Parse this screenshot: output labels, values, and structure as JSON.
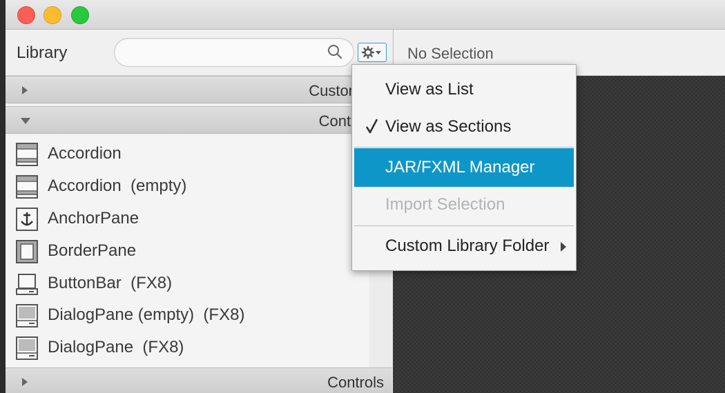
{
  "library": {
    "title": "Library",
    "search": {
      "placeholder": "",
      "value": ""
    },
    "sections": [
      {
        "label": "Custom",
        "expanded": false
      },
      {
        "label": "Containers",
        "expanded": true
      },
      {
        "label": "Controls",
        "expanded": false
      }
    ],
    "items": [
      {
        "label": "Accordion",
        "icon": "accordion-icon"
      },
      {
        "label": "Accordion  (empty)",
        "icon": "accordion-icon"
      },
      {
        "label": "AnchorPane",
        "icon": "anchor-icon"
      },
      {
        "label": "BorderPane",
        "icon": "borderpane-icon"
      },
      {
        "label": "ButtonBar  (FX8)",
        "icon": "buttonbar-icon"
      },
      {
        "label": "DialogPane (empty)  (FX8)",
        "icon": "dialogpane-icon"
      },
      {
        "label": "DialogPane  (FX8)",
        "icon": "dialogpane-icon"
      }
    ]
  },
  "inspector": {
    "title": "No Selection"
  },
  "menu": {
    "items": [
      {
        "label": "View as List",
        "checked": false,
        "disabled": false,
        "selected": false
      },
      {
        "label": "View as Sections",
        "checked": true,
        "disabled": false,
        "selected": false
      },
      {
        "label": "JAR/FXML Manager",
        "checked": false,
        "disabled": false,
        "selected": true
      },
      {
        "label": "Import Selection",
        "checked": false,
        "disabled": true,
        "selected": false
      },
      {
        "label": "Custom Library Folder",
        "checked": false,
        "disabled": false,
        "selected": false,
        "submenu": true
      }
    ]
  },
  "colors": {
    "accent": "#0f96c8",
    "focus_ring": "#3a9ad8"
  }
}
